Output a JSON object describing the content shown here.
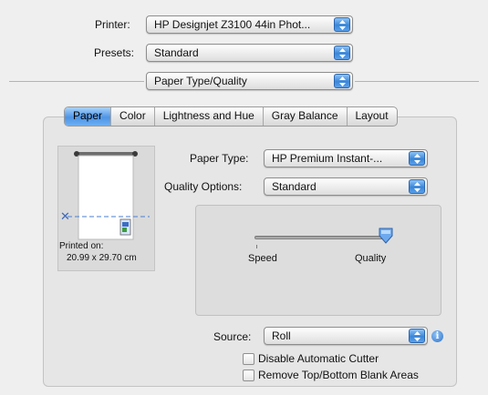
{
  "printer": {
    "label": "Printer:",
    "value": "HP Designjet Z3100 44in Phot..."
  },
  "presets": {
    "label": "Presets:",
    "value": "Standard"
  },
  "panel_selector": {
    "value": "Paper Type/Quality"
  },
  "tabs": [
    {
      "label": "Paper",
      "active": true
    },
    {
      "label": "Color",
      "active": false
    },
    {
      "label": "Lightness and Hue",
      "active": false
    },
    {
      "label": "Gray Balance",
      "active": false
    },
    {
      "label": "Layout",
      "active": false
    }
  ],
  "preview": {
    "printed_on_label": "Printed on:",
    "size": "20.99 x 29.70 cm"
  },
  "paper_type": {
    "label": "Paper Type:",
    "value": "HP Premium Instant-..."
  },
  "quality_options": {
    "label": "Quality Options:",
    "value": "Standard"
  },
  "quality_slider": {
    "min_label": "Speed",
    "max_label": "Quality",
    "value_fraction": 1.0
  },
  "source": {
    "label": "Source:",
    "value": "Roll"
  },
  "checkboxes": [
    {
      "label": "Disable Automatic Cutter",
      "checked": false
    },
    {
      "label": "Remove Top/Bottom Blank Areas",
      "checked": false
    }
  ],
  "icons": {
    "popup_arrows": "updown-arrows-icon",
    "info": "info-icon",
    "scissors": "scissors-icon",
    "paper_roll": "paper-roll-icon"
  },
  "colors": {
    "accent": "#4c95e6",
    "background": "#efefef",
    "panel": "#e6e6e6"
  }
}
